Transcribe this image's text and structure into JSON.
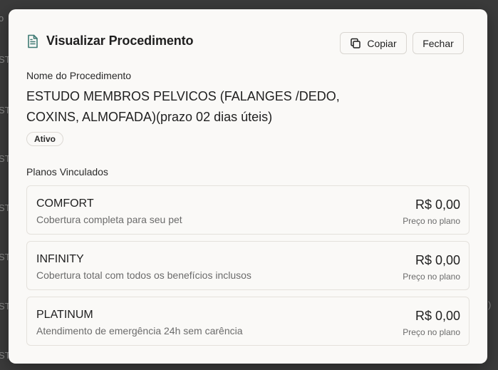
{
  "background": {
    "left_fragments": [
      "o",
      "ST",
      "ST",
      "ST",
      "ST",
      "ST",
      "ST",
      "ST",
      "ST"
    ],
    "right_fragment": ")"
  },
  "modal": {
    "title": "Visualizar Procedimento",
    "copy_label": "Copiar",
    "close_label": "Fechar",
    "field_label": "Nome do Procedimento",
    "procedure_name": "ESTUDO MEMBROS PELVICOS (FALANGES /DEDO, COXINS, ALMOFADA)(prazo 02 dias úteis)",
    "status_badge": "Ativo",
    "plans_label": "Planos Vinculados",
    "plans": [
      {
        "name": "COMFORT",
        "description": "Cobertura completa para seu pet",
        "price": "R$ 0,00",
        "price_label": "Preço no plano"
      },
      {
        "name": "INFINITY",
        "description": "Cobertura total com todos os benefícios inclusos",
        "price": "R$ 0,00",
        "price_label": "Preço no plano"
      },
      {
        "name": "PLATINUM",
        "description": "Atendimento de emergência 24h sem carência",
        "price": "R$ 0,00",
        "price_label": "Preço no plano"
      }
    ]
  },
  "colors": {
    "overlay": "#3b3b3b",
    "modal_bg": "#faf9f7",
    "border": "#e4e1dc",
    "text": "#1f1f1f",
    "muted": "#6b6b6b"
  },
  "icons": {
    "title": "document-icon",
    "copy": "copy-icon"
  }
}
